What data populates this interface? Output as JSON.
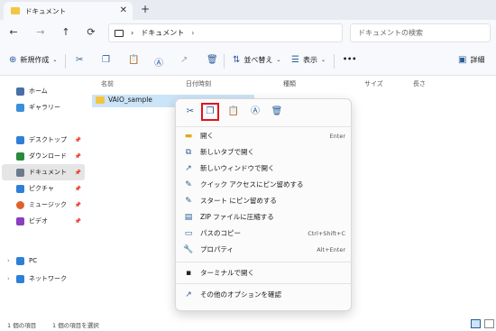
{
  "window": {
    "tab_title": "ドキュメント",
    "tab_close": "✕",
    "new_tab": "+"
  },
  "address": {
    "back": "←",
    "forward": "→",
    "up": "↑",
    "refresh": "⟳",
    "chevron": "›",
    "current": "ドキュメント",
    "search_placeholder": "ドキュメントの検索"
  },
  "toolbar": {
    "new_label": "新規作成",
    "sort_label": "並べ替え",
    "view_label": "表示",
    "more": "•••",
    "details_label": "詳細"
  },
  "sidebar": {
    "items": [
      {
        "label": "ホーム",
        "icon": "home-icon",
        "color": "#4a6fa5"
      },
      {
        "label": "ギャラリー",
        "icon": "gallery-icon",
        "color": "#3a8fd9"
      },
      {
        "label": "デスクトップ",
        "icon": "desktop-icon",
        "color": "#2f7fd8"
      },
      {
        "label": "ダウンロード",
        "icon": "download-icon",
        "color": "#2b8a3e"
      },
      {
        "label": "ドキュメント",
        "icon": "documents-icon",
        "color": "#6b7b8c"
      },
      {
        "label": "ピクチャ",
        "icon": "pictures-icon",
        "color": "#2f7fd8"
      },
      {
        "label": "ミュージック",
        "icon": "music-icon",
        "color": "#e06030"
      },
      {
        "label": "ビデオ",
        "icon": "videos-icon",
        "color": "#8a3fbf"
      },
      {
        "label": "PC",
        "icon": "pc-icon",
        "color": "#2f7fd8"
      },
      {
        "label": "ネットワーク",
        "icon": "network-icon",
        "color": "#2f7fd8"
      }
    ]
  },
  "content": {
    "columns": [
      "名前",
      "日付時刻",
      "種類",
      "サイズ",
      "長さ"
    ],
    "rows": [
      {
        "name": "VAIO_sample"
      }
    ]
  },
  "context_menu": {
    "items": [
      {
        "label": "開く",
        "shortcut": "Enter",
        "icon": "open-icon"
      },
      {
        "label": "新しいタブで開く",
        "shortcut": "",
        "icon": "new-tab-icon"
      },
      {
        "label": "新しいウィンドウで開く",
        "shortcut": "",
        "icon": "new-window-icon"
      },
      {
        "label": "クイック アクセスにピン留めする",
        "shortcut": "",
        "icon": "pin-icon"
      },
      {
        "label": "スタート にピン留めする",
        "shortcut": "",
        "icon": "pin-start-icon"
      },
      {
        "label": "ZIP ファイルに圧縮する",
        "shortcut": "",
        "icon": "zip-icon"
      },
      {
        "label": "パスのコピー",
        "shortcut": "Ctrl+Shift+C",
        "icon": "copy-path-icon"
      },
      {
        "label": "プロパティ",
        "shortcut": "Alt+Enter",
        "icon": "properties-icon"
      },
      {
        "label": "ターミナルで開く",
        "shortcut": "",
        "icon": "terminal-icon"
      },
      {
        "label": "その他のオプションを確認",
        "shortcut": "",
        "icon": "more-options-icon"
      }
    ]
  },
  "status": {
    "item_count": "1 個の項目",
    "selected": "1 個の項目を選択"
  },
  "colors": {
    "accent": "#2b5c9a",
    "highlight": "#e0141e",
    "selection": "#cce4f7"
  }
}
